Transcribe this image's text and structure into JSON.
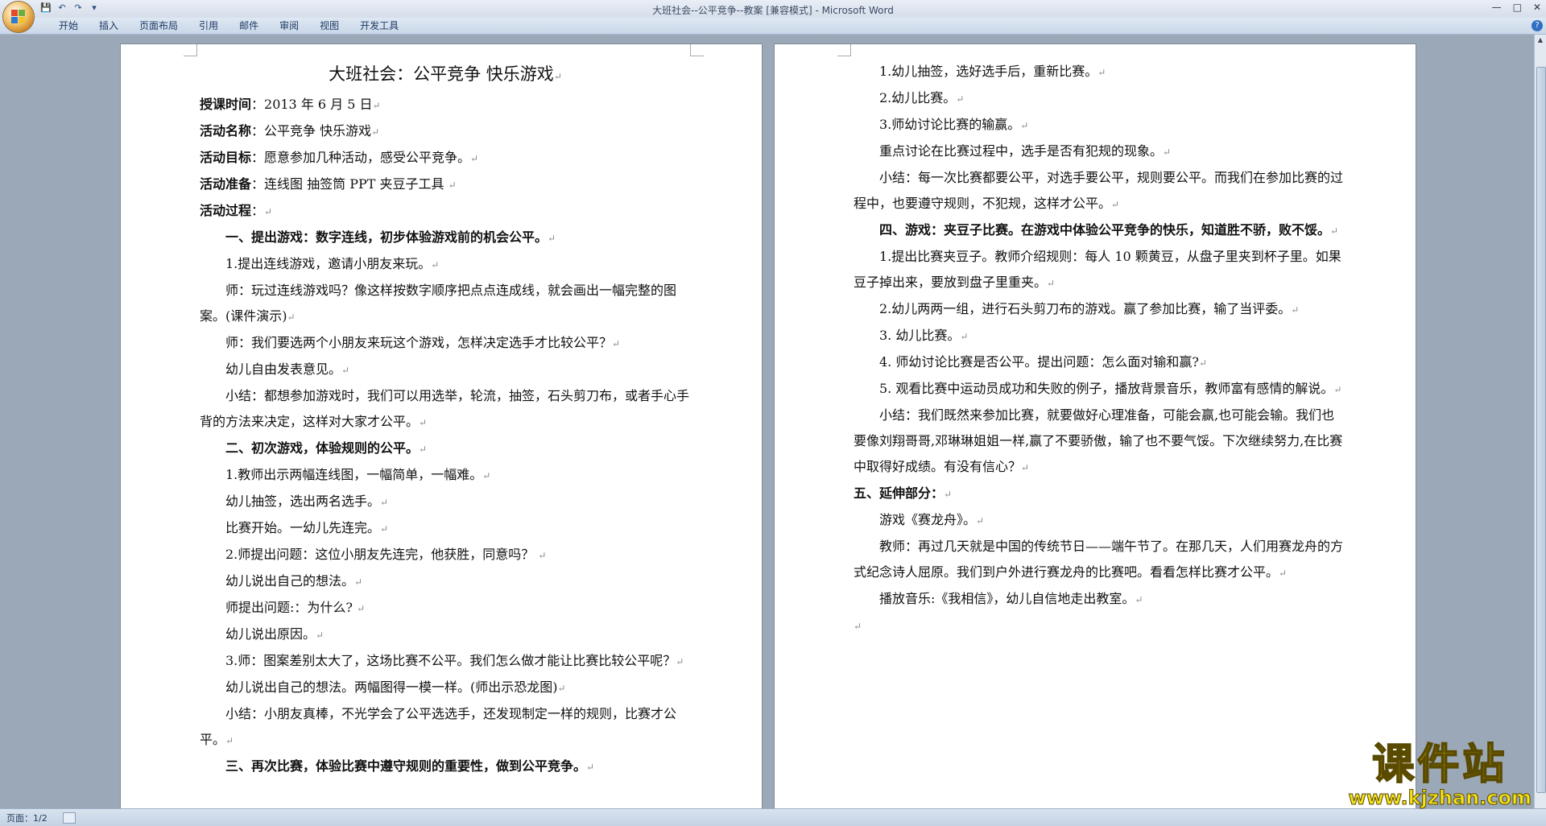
{
  "window": {
    "title": "大班社会--公平竞争--教案 [兼容模式] - Microsoft Word",
    "controls": [
      "—",
      "□",
      "✕"
    ]
  },
  "quick_access": [
    {
      "name": "save-icon",
      "glyph": "💾"
    },
    {
      "name": "undo-icon",
      "glyph": "↶"
    },
    {
      "name": "redo-icon",
      "glyph": "↷"
    },
    {
      "name": "customize-icon",
      "glyph": "▾"
    }
  ],
  "ribbon": {
    "tabs": [
      "开始",
      "插入",
      "页面布局",
      "引用",
      "邮件",
      "审阅",
      "视图",
      "开发工具"
    ],
    "help": "?"
  },
  "document": {
    "title": "大班社会：公平竞争 快乐游戏",
    "page1": [
      {
        "label": "授课时间",
        "text": "：2013 年 6 月 5 日"
      },
      {
        "label": "活动名称",
        "text": "：公平竞争 快乐游戏"
      },
      {
        "label": "活动目标",
        "text": "：愿意参加几种活动，感受公平竞争。"
      },
      {
        "label": "活动准备",
        "text": "：连线图 抽签筒 PPT 夹豆子工具 "
      },
      {
        "label": "活动过程",
        "text": "："
      },
      {
        "bold": "一、提出游戏：数字连线，初步体验游戏前的机会公平。"
      },
      {
        "text": "1.提出连线游戏，邀请小朋友来玩。"
      },
      {
        "text": "师：玩过连线游戏吗？像这样按数字顺序把点点连成线，就会画出一幅完整的图案。(课件演示)"
      },
      {
        "text": "师：我们要选两个小朋友来玩这个游戏，怎样决定选手才比较公平？"
      },
      {
        "text": "幼儿自由发表意见。"
      },
      {
        "text": "小结：都想参加游戏时，我们可以用选举，轮流，抽签，石头剪刀布，或者手心手背的方法来决定，这样对大家才公平。"
      },
      {
        "bold": "二、初次游戏，体验规则的公平。"
      },
      {
        "text": "1.教师出示两幅连线图，一幅简单，一幅难。"
      },
      {
        "text": "幼儿抽签，选出两名选手。"
      },
      {
        "text": "比赛开始。一幼儿先连完。"
      },
      {
        "text": "2.师提出问题：这位小朋友先连完，他获胜，同意吗？ "
      },
      {
        "text": "幼儿说出自己的想法。"
      },
      {
        "text": "师提出问题:：为什么?      "
      },
      {
        "text": "幼儿说出原因。"
      },
      {
        "text": "3.师：图案差别太大了，这场比赛不公平。我们怎么做才能让比赛比较公平呢？"
      },
      {
        "text": "幼儿说出自己的想法。两幅图得一模一样。(师出示恐龙图)"
      },
      {
        "text": "小结：小朋友真棒，不光学会了公平选选手，还发现制定一样的规则，比赛才公平。"
      },
      {
        "bold": "三、再次比赛，体验比赛中遵守规则的重要性，做到公平竞争。"
      }
    ],
    "page2": [
      {
        "text": "1.幼儿抽签，选好选手后，重新比赛。"
      },
      {
        "text": "2.幼儿比赛。"
      },
      {
        "text": "3.师幼讨论比赛的输赢。"
      },
      {
        "text": "重点讨论在比赛过程中，选手是否有犯规的现象。"
      },
      {
        "text": "小结：每一次比赛都要公平，对选手要公平，规则要公平。而我们在参加比赛的过程中，也要遵守规则，不犯规，这样才公平。"
      },
      {
        "bold": "四、游戏：夹豆子比赛。在游戏中体验公平竞争的快乐，知道胜不骄，败不馁。"
      },
      {
        "text": "1.提出比赛夹豆子。教师介绍规则：每人 10 颗黄豆，从盘子里夹到杯子里。如果豆子掉出来，要放到盘子里重夹。"
      },
      {
        "text": "2.幼儿两两一组，进行石头剪刀布的游戏。赢了参加比赛，输了当评委。"
      },
      {
        "text": "3. 幼儿比赛。"
      },
      {
        "text": "4. 师幼讨论比赛是否公平。提出问题：怎么面对输和赢?"
      },
      {
        "text": "5. 观看比赛中运动员成功和失败的例子，播放背景音乐，教师富有感情的解说。"
      },
      {
        "text": "小结：我们既然来参加比赛，就要做好心理准备，可能会赢,也可能会输。我们也要像刘翔哥哥,邓琳琳姐姐一样,赢了不要骄傲，输了也不要气馁。下次继续努力,在比赛中取得好成绩。有没有信心？"
      },
      {
        "bold": "五、延伸部分：",
        "noindent": true
      },
      {
        "text": "游戏《赛龙舟》。"
      },
      {
        "text": "教师：再过几天就是中国的传统节日——端午节了。在那几天，人们用赛龙舟的方式纪念诗人屈原。我们到户外进行赛龙舟的比赛吧。看看怎样比赛才公平。"
      },
      {
        "text": "播放音乐:《我相信》，幼儿自信地走出教室。"
      },
      {
        "text": "",
        "noindent": true
      }
    ],
    "paragraph_mark": "↵"
  },
  "status": {
    "page": "页面：1/2"
  },
  "watermark": {
    "cn": "课件站",
    "url": "www.kjzhan.com"
  },
  "colors": {
    "watermark": "#f3e21a",
    "ribbon": "#c9d7e8",
    "workspace": "#9ba8b8"
  }
}
